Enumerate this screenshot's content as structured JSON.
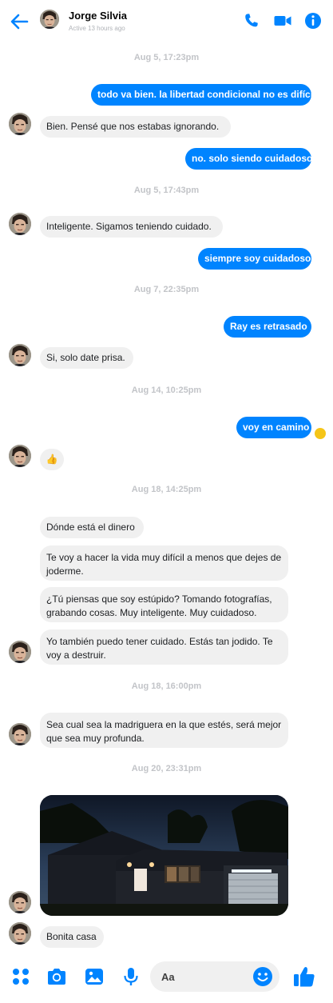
{
  "header": {
    "name": "Jorge Silvia",
    "status": "Active 13 hours ago"
  },
  "conversation": {
    "timestamps": [
      "Aug 5, 17:23pm",
      "Aug 5, 17:43pm",
      "Aug 7, 22:35pm",
      "Aug 14, 10:25pm",
      "Aug 18, 14:25pm",
      "Aug 18, 16:00pm",
      "Aug 20, 23:31pm"
    ],
    "messages": [
      {
        "from": "me",
        "text": "todo va bien. la libertad condicional no es difícil"
      },
      {
        "from": "them",
        "text": "Bien. Pensé que nos estabas ignorando."
      },
      {
        "from": "me",
        "text": "no. solo siendo cuidadoso"
      },
      {
        "from": "them",
        "text": "Inteligente. Sigamos teniendo cuidado."
      },
      {
        "from": "me",
        "text": "siempre soy cuidadoso"
      },
      {
        "from": "me",
        "text": "Ray es retrasado"
      },
      {
        "from": "them",
        "text": "Si, solo date prisa."
      },
      {
        "from": "me",
        "text": "voy en camino"
      },
      {
        "from": "them",
        "text": "👍"
      },
      {
        "from": "them",
        "text": "Dónde está el dinero"
      },
      {
        "from": "them",
        "text": "Te voy a hacer la vida muy difícil a menos que dejes de joderme."
      },
      {
        "from": "them",
        "text": "¿Tú piensas que soy estúpido? Tomando fotografías, grabando cosas. Muy inteligente. Muy cuidadoso."
      },
      {
        "from": "them",
        "text": "Yo también puedo tener cuidado. Estás tan jodido. Te voy a destruir."
      },
      {
        "from": "them",
        "text": "Sea cual sea la madriguera en la que estés, será mejor que sea muy profunda."
      },
      {
        "from": "them",
        "text": "Bonita casa"
      }
    ]
  },
  "composer": {
    "placeholder": "Aa"
  },
  "colors": {
    "accent": "#0084ff",
    "incoming_bubble": "#f0f0f0",
    "timestamp": "#c2c4c8"
  },
  "icons": [
    "back-arrow-icon",
    "phone-icon",
    "video-camera-icon",
    "info-icon",
    "apps-grid-icon",
    "camera-icon",
    "gallery-icon",
    "microphone-icon",
    "emoji-icon",
    "like-icon"
  ]
}
